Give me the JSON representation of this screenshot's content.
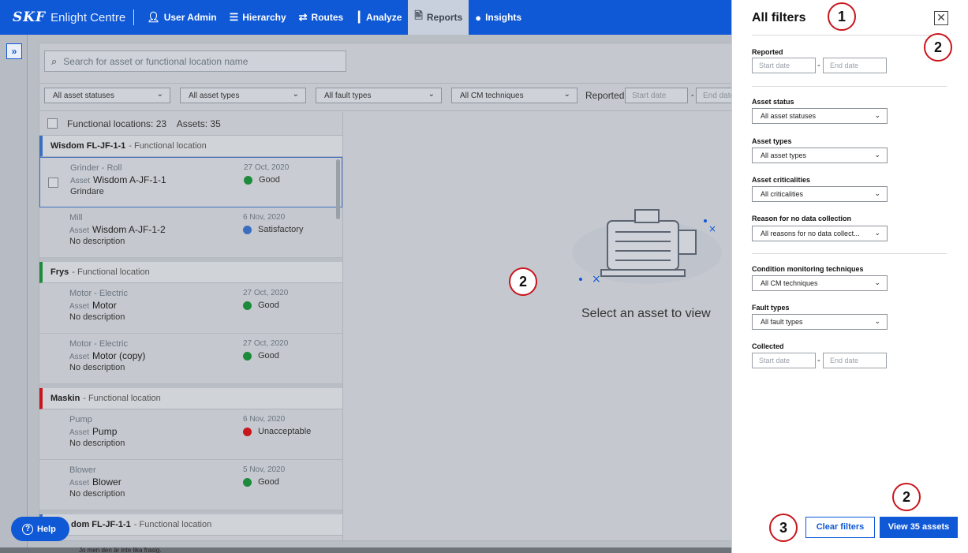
{
  "topbar": {
    "logo": "SKF",
    "product": "Enlight Centre",
    "nav": [
      {
        "label": "User Admin",
        "icon": "user-icon"
      },
      {
        "label": "Hierarchy",
        "icon": "hierarchy-icon"
      },
      {
        "label": "Routes",
        "icon": "routes-icon"
      },
      {
        "label": "Analyze",
        "icon": "chart-icon"
      },
      {
        "label": "Reports",
        "icon": "document-icon"
      },
      {
        "label": "Insights",
        "icon": "lightbulb-icon"
      }
    ],
    "active": "Reports",
    "accent": "#0f58d6"
  },
  "search": {
    "placeholder": "Search for asset or functional location name"
  },
  "filterbar": {
    "asset_statuses": "All asset statuses",
    "asset_types": "All asset types",
    "fault_types": "All fault types",
    "cm_techniques": "All CM techniques",
    "reported_label": "Reported",
    "start_date": "Start date",
    "end_date": "End date"
  },
  "list": {
    "header": "Functional locations: 23    Assets: 35",
    "groups": [
      {
        "name": "Wisdom FL-JF-1-1",
        "suffix": "- Functional location",
        "color": "#3c6ebf",
        "assets": [
          {
            "type": "Grinder - Roll",
            "prefix": "Asset",
            "name": "Wisdom A-JF-1-1",
            "desc": "Grindare",
            "date": "27 Oct, 2020",
            "status": "Good",
            "status_color": "#1e8a3c"
          },
          {
            "type": "Mill",
            "prefix": "Asset",
            "name": "Wisdom A-JF-1-2",
            "desc": "No description",
            "date": "6 Nov, 2020",
            "status": "Satisfactory",
            "status_color": "#3c6ebf"
          }
        ]
      },
      {
        "name": "Frys",
        "suffix": "- Functional location",
        "color": "#1e8a3c",
        "assets": [
          {
            "type": "Motor - Electric",
            "prefix": "Asset",
            "name": "Motor",
            "desc": "No description",
            "date": "27 Oct, 2020",
            "status": "Good",
            "status_color": "#1e8a3c"
          },
          {
            "type": "Motor - Electric",
            "prefix": "Asset",
            "name": "Motor (copy)",
            "desc": "No description",
            "date": "27 Oct, 2020",
            "status": "Good",
            "status_color": "#1e8a3c"
          }
        ]
      },
      {
        "name": "Maskin",
        "suffix": "- Functional location",
        "color": "#c8161d",
        "assets": [
          {
            "type": "Pump",
            "prefix": "Asset",
            "name": "Pump",
            "desc": "No description",
            "date": "6 Nov, 2020",
            "status": "Unacceptable",
            "status_color": "#c8161d"
          },
          {
            "type": "Blower",
            "prefix": "Asset",
            "name": "Blower",
            "desc": "No description",
            "date": "5 Nov, 2020",
            "status": "Good",
            "status_color": "#1e8a3c"
          }
        ]
      },
      {
        "name": "dom FL-JF-1-1",
        "suffix": "- Functional location",
        "color": "#3c6ebf",
        "assets": []
      }
    ]
  },
  "empty_state": "Select an asset to view",
  "help": "Help",
  "bottom_text": "Jo men den är inte lika frasig.",
  "drawer": {
    "title": "All filters",
    "reported": "Reported",
    "start_date": "Start date",
    "end_date": "End date",
    "asset_status_label": "Asset status",
    "asset_status_value": "All asset statuses",
    "asset_types_label": "Asset types",
    "asset_types_value": "All asset types",
    "criticalities_label": "Asset criticalities",
    "criticalities_value": "All criticalities",
    "no_data_label": "Reason for no data collection",
    "no_data_value": "All reasons for no data collect...",
    "cm_label": "Condition monitoring techniques",
    "cm_value": "All CM techniques",
    "fault_label": "Fault types",
    "fault_value": "All fault types",
    "collected_label": "Collected",
    "clear": "Clear filters",
    "view": "View 35 assets"
  },
  "callouts": {
    "one": "1",
    "two": "2",
    "three": "3"
  }
}
